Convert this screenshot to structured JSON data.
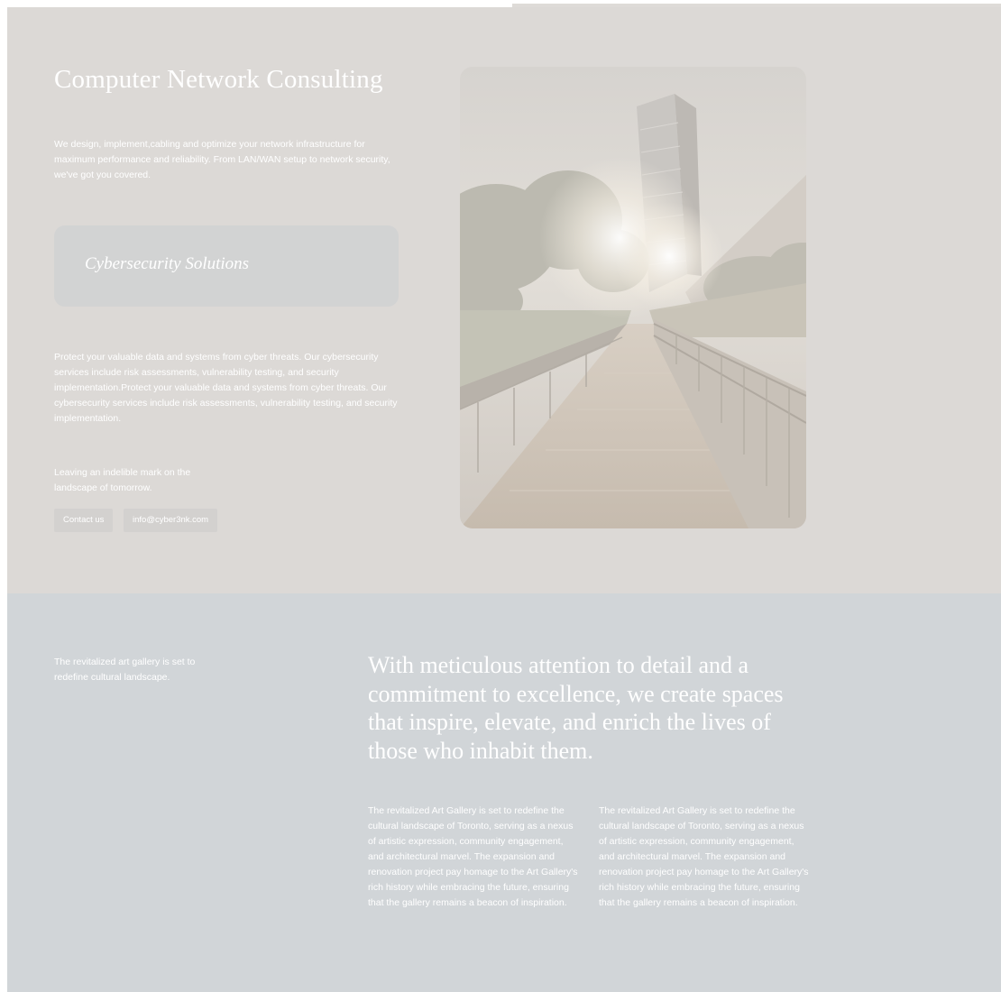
{
  "hero": {
    "title": "Computer Network Consulting",
    "intro": "We design, implement,cabling and optimize your network infrastructure for maximum performance and reliability. From LAN/WAN setup to network security, we've got you covered.",
    "service": {
      "title": "Cybersecurity Solutions",
      "description": "Protect your valuable data and systems from cyber threats. Our cybersecurity services include risk assessments, vulnerability testing, and security implementation.Protect your valuable data and systems from cyber threats. Our cybersecurity services include risk assessments, vulnerability testing, and security implementation."
    },
    "tagline": "Leaving an indelible mark on the landscape of tomorrow.",
    "buttons": {
      "contact_label": "Contact us",
      "email_label": "info@cyber3nk.com"
    }
  },
  "section2": {
    "note": "The revitalized art gallery is set to redefine cultural landscape.",
    "quote": "With meticulous attention to detail and a commitment to excellence, we create spaces that inspire, elevate, and enrich the lives of those who inhabit them.",
    "columns": [
      "The revitalized Art Gallery is set to redefine the cultural landscape of Toronto, serving as a nexus of artistic expression, community engagement, and architectural marvel. The expansion and renovation project pay homage to the Art Gallery's rich history while embracing the future, ensuring that the gallery remains a beacon of inspiration.",
      "The revitalized Art Gallery is set to redefine the cultural landscape of Toronto, serving as a nexus of artistic expression, community engagement, and architectural marvel. The expansion and renovation project pay homage to the Art Gallery's rich history while embracing the future, ensuring that the gallery remains a beacon of inspiration."
    ]
  },
  "colors": {
    "hero_background": "#dcd9d6",
    "section_background": "#d1d5d8",
    "card_background": "#d2d3d3",
    "text": "#ffffff"
  }
}
